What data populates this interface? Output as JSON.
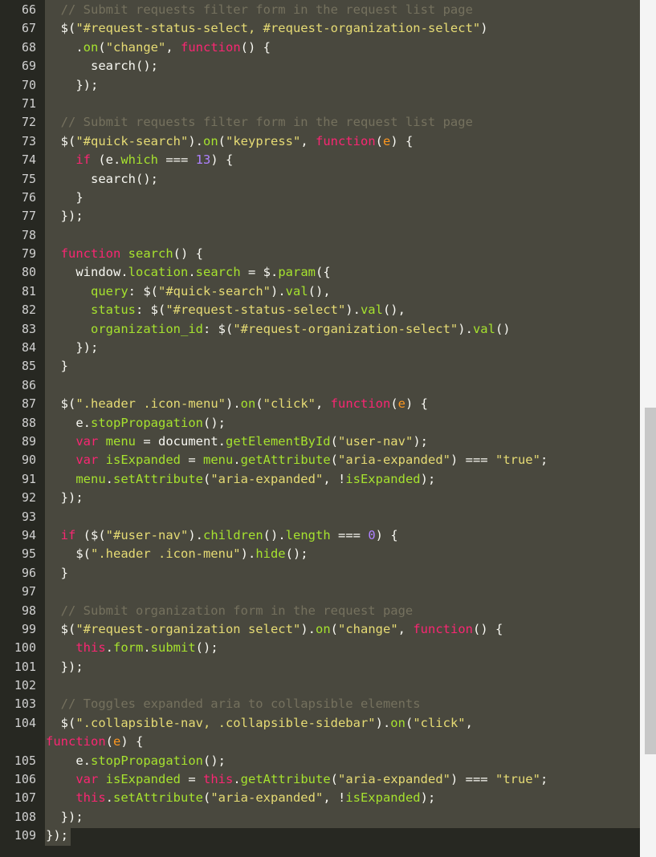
{
  "editor": {
    "lines": [
      {
        "n": "66",
        "tokens": [
          [
            "comment",
            "  // Submit requests filter form in the request list page"
          ]
        ]
      },
      {
        "n": "67",
        "tokens": [
          [
            "plain",
            "  $("
          ],
          [
            "string",
            "\"#request-status-select, #request-organization-select\""
          ],
          [
            "plain",
            ")"
          ]
        ]
      },
      {
        "n": "68",
        "tokens": [
          [
            "plain",
            "    ."
          ],
          [
            "method",
            "on"
          ],
          [
            "plain",
            "("
          ],
          [
            "string",
            "\"change\""
          ],
          [
            "plain",
            ", "
          ],
          [
            "keyword",
            "function"
          ],
          [
            "plain",
            "() {"
          ]
        ]
      },
      {
        "n": "69",
        "tokens": [
          [
            "plain",
            "      search();"
          ]
        ]
      },
      {
        "n": "70",
        "tokens": [
          [
            "plain",
            "    });"
          ]
        ]
      },
      {
        "n": "71",
        "tokens": []
      },
      {
        "n": "72",
        "tokens": [
          [
            "comment",
            "  // Submit requests filter form in the request list page"
          ]
        ]
      },
      {
        "n": "73",
        "tokens": [
          [
            "plain",
            "  $("
          ],
          [
            "string",
            "\"#quick-search\""
          ],
          [
            "plain",
            ")."
          ],
          [
            "method",
            "on"
          ],
          [
            "plain",
            "("
          ],
          [
            "string",
            "\"keypress\""
          ],
          [
            "plain",
            ", "
          ],
          [
            "keyword",
            "function"
          ],
          [
            "plain",
            "("
          ],
          [
            "param",
            "e"
          ],
          [
            "plain",
            ") {"
          ]
        ]
      },
      {
        "n": "74",
        "tokens": [
          [
            "plain",
            "    "
          ],
          [
            "keyword",
            "if"
          ],
          [
            "plain",
            " (e."
          ],
          [
            "method",
            "which"
          ],
          [
            "plain",
            " === "
          ],
          [
            "number",
            "13"
          ],
          [
            "plain",
            ") {"
          ]
        ]
      },
      {
        "n": "75",
        "tokens": [
          [
            "plain",
            "      search();"
          ]
        ]
      },
      {
        "n": "76",
        "tokens": [
          [
            "plain",
            "    }"
          ]
        ]
      },
      {
        "n": "77",
        "tokens": [
          [
            "plain",
            "  });"
          ]
        ]
      },
      {
        "n": "78",
        "tokens": []
      },
      {
        "n": "79",
        "tokens": [
          [
            "plain",
            "  "
          ],
          [
            "keyword",
            "function"
          ],
          [
            "plain",
            " "
          ],
          [
            "func",
            "search"
          ],
          [
            "plain",
            "() {"
          ]
        ]
      },
      {
        "n": "80",
        "tokens": [
          [
            "plain",
            "    window."
          ],
          [
            "method",
            "location"
          ],
          [
            "plain",
            "."
          ],
          [
            "method",
            "search"
          ],
          [
            "plain",
            " = $."
          ],
          [
            "method",
            "param"
          ],
          [
            "plain",
            "({"
          ]
        ]
      },
      {
        "n": "81",
        "tokens": [
          [
            "plain",
            "      "
          ],
          [
            "method",
            "query"
          ],
          [
            "plain",
            ": $("
          ],
          [
            "string",
            "\"#quick-search\""
          ],
          [
            "plain",
            ")."
          ],
          [
            "method",
            "val"
          ],
          [
            "plain",
            "(),"
          ]
        ]
      },
      {
        "n": "82",
        "tokens": [
          [
            "plain",
            "      "
          ],
          [
            "method",
            "status"
          ],
          [
            "plain",
            ": $("
          ],
          [
            "string",
            "\"#request-status-select\""
          ],
          [
            "plain",
            ")."
          ],
          [
            "method",
            "val"
          ],
          [
            "plain",
            "(),"
          ]
        ]
      },
      {
        "n": "83",
        "tokens": [
          [
            "plain",
            "      "
          ],
          [
            "method",
            "organization_id"
          ],
          [
            "plain",
            ": $("
          ],
          [
            "string",
            "\"#request-organization-select\""
          ],
          [
            "plain",
            ")."
          ],
          [
            "method",
            "val"
          ],
          [
            "plain",
            "()"
          ]
        ]
      },
      {
        "n": "84",
        "tokens": [
          [
            "plain",
            "    });"
          ]
        ]
      },
      {
        "n": "85",
        "tokens": [
          [
            "plain",
            "  }"
          ]
        ]
      },
      {
        "n": "86",
        "tokens": []
      },
      {
        "n": "87",
        "tokens": [
          [
            "plain",
            "  $("
          ],
          [
            "string",
            "\".header .icon-menu\""
          ],
          [
            "plain",
            ")."
          ],
          [
            "method",
            "on"
          ],
          [
            "plain",
            "("
          ],
          [
            "string",
            "\"click\""
          ],
          [
            "plain",
            ", "
          ],
          [
            "keyword",
            "function"
          ],
          [
            "plain",
            "("
          ],
          [
            "param",
            "e"
          ],
          [
            "plain",
            ") {"
          ]
        ]
      },
      {
        "n": "88",
        "tokens": [
          [
            "plain",
            "    e."
          ],
          [
            "method",
            "stopPropagation"
          ],
          [
            "plain",
            "();"
          ]
        ]
      },
      {
        "n": "89",
        "tokens": [
          [
            "plain",
            "    "
          ],
          [
            "keyword",
            "var"
          ],
          [
            "plain",
            " "
          ],
          [
            "method",
            "menu"
          ],
          [
            "plain",
            " = document."
          ],
          [
            "method",
            "getElementById"
          ],
          [
            "plain",
            "("
          ],
          [
            "string",
            "\"user-nav\""
          ],
          [
            "plain",
            ");"
          ]
        ]
      },
      {
        "n": "90",
        "tokens": [
          [
            "plain",
            "    "
          ],
          [
            "keyword",
            "var"
          ],
          [
            "plain",
            " "
          ],
          [
            "method",
            "isExpanded"
          ],
          [
            "plain",
            " = "
          ],
          [
            "method",
            "menu"
          ],
          [
            "plain",
            "."
          ],
          [
            "method",
            "getAttribute"
          ],
          [
            "plain",
            "("
          ],
          [
            "string",
            "\"aria-expanded\""
          ],
          [
            "plain",
            ") === "
          ],
          [
            "string",
            "\"true\""
          ],
          [
            "plain",
            ";"
          ]
        ]
      },
      {
        "n": "91",
        "tokens": [
          [
            "plain",
            "    "
          ],
          [
            "method",
            "menu"
          ],
          [
            "plain",
            "."
          ],
          [
            "method",
            "setAttribute"
          ],
          [
            "plain",
            "("
          ],
          [
            "string",
            "\"aria-expanded\""
          ],
          [
            "plain",
            ", !"
          ],
          [
            "method",
            "isExpanded"
          ],
          [
            "plain",
            ");"
          ]
        ]
      },
      {
        "n": "92",
        "tokens": [
          [
            "plain",
            "  });"
          ]
        ]
      },
      {
        "n": "93",
        "tokens": []
      },
      {
        "n": "94",
        "tokens": [
          [
            "plain",
            "  "
          ],
          [
            "keyword",
            "if"
          ],
          [
            "plain",
            " ($("
          ],
          [
            "string",
            "\"#user-nav\""
          ],
          [
            "plain",
            ")."
          ],
          [
            "method",
            "children"
          ],
          [
            "plain",
            "()."
          ],
          [
            "method",
            "length"
          ],
          [
            "plain",
            " === "
          ],
          [
            "number",
            "0"
          ],
          [
            "plain",
            ") {"
          ]
        ]
      },
      {
        "n": "95",
        "tokens": [
          [
            "plain",
            "    $("
          ],
          [
            "string",
            "\".header .icon-menu\""
          ],
          [
            "plain",
            ")."
          ],
          [
            "method",
            "hide"
          ],
          [
            "plain",
            "();"
          ]
        ]
      },
      {
        "n": "96",
        "tokens": [
          [
            "plain",
            "  }"
          ]
        ]
      },
      {
        "n": "97",
        "tokens": []
      },
      {
        "n": "98",
        "tokens": [
          [
            "comment",
            "  // Submit organization form in the request page"
          ]
        ]
      },
      {
        "n": "99",
        "tokens": [
          [
            "plain",
            "  $("
          ],
          [
            "string",
            "\"#request-organization select\""
          ],
          [
            "plain",
            ")."
          ],
          [
            "method",
            "on"
          ],
          [
            "plain",
            "("
          ],
          [
            "string",
            "\"change\""
          ],
          [
            "plain",
            ", "
          ],
          [
            "keyword",
            "function"
          ],
          [
            "plain",
            "() {"
          ]
        ]
      },
      {
        "n": "100",
        "tokens": [
          [
            "plain",
            "    "
          ],
          [
            "keyword",
            "this"
          ],
          [
            "plain",
            "."
          ],
          [
            "method",
            "form"
          ],
          [
            "plain",
            "."
          ],
          [
            "method",
            "submit"
          ],
          [
            "plain",
            "();"
          ]
        ]
      },
      {
        "n": "101",
        "tokens": [
          [
            "plain",
            "  });"
          ]
        ]
      },
      {
        "n": "102",
        "tokens": []
      },
      {
        "n": "103",
        "tokens": [
          [
            "comment",
            "  // Toggles expanded aria to collapsible elements"
          ]
        ]
      },
      {
        "n": "104",
        "wrap": true,
        "tokens": [
          [
            "plain",
            "  $("
          ],
          [
            "string",
            "\".collapsible-nav, .collapsible-sidebar\""
          ],
          [
            "plain",
            ")."
          ],
          [
            "method",
            "on"
          ],
          [
            "plain",
            "("
          ],
          [
            "string",
            "\"click\""
          ],
          [
            "plain",
            ",\n"
          ],
          [
            "keyword",
            "function"
          ],
          [
            "plain",
            "("
          ],
          [
            "param",
            "e"
          ],
          [
            "plain",
            ") {"
          ]
        ]
      },
      {
        "n": "105",
        "tokens": [
          [
            "plain",
            "    e."
          ],
          [
            "method",
            "stopPropagation"
          ],
          [
            "plain",
            "();"
          ]
        ]
      },
      {
        "n": "106",
        "tokens": [
          [
            "plain",
            "    "
          ],
          [
            "keyword",
            "var"
          ],
          [
            "plain",
            " "
          ],
          [
            "method",
            "isExpanded"
          ],
          [
            "plain",
            " = "
          ],
          [
            "keyword",
            "this"
          ],
          [
            "plain",
            "."
          ],
          [
            "method",
            "getAttribute"
          ],
          [
            "plain",
            "("
          ],
          [
            "string",
            "\"aria-expanded\""
          ],
          [
            "plain",
            ") === "
          ],
          [
            "string",
            "\"true\""
          ],
          [
            "plain",
            ";"
          ]
        ]
      },
      {
        "n": "107",
        "tokens": [
          [
            "plain",
            "    "
          ],
          [
            "keyword",
            "this"
          ],
          [
            "plain",
            "."
          ],
          [
            "method",
            "setAttribute"
          ],
          [
            "plain",
            "("
          ],
          [
            "string",
            "\"aria-expanded\""
          ],
          [
            "plain",
            ", !"
          ],
          [
            "method",
            "isExpanded"
          ],
          [
            "plain",
            ");"
          ]
        ]
      },
      {
        "n": "108",
        "tokens": [
          [
            "plain",
            "  });"
          ]
        ]
      },
      {
        "n": "109",
        "tokens": [
          [
            "plain",
            "});"
          ]
        ]
      }
    ]
  },
  "colors": {
    "background": "#272822",
    "selection": "#49483e",
    "comment": "#75715e",
    "string": "#e6db74",
    "keyword": "#f92672",
    "method": "#a6e22e",
    "param": "#fd971f",
    "number": "#ae81ff"
  }
}
